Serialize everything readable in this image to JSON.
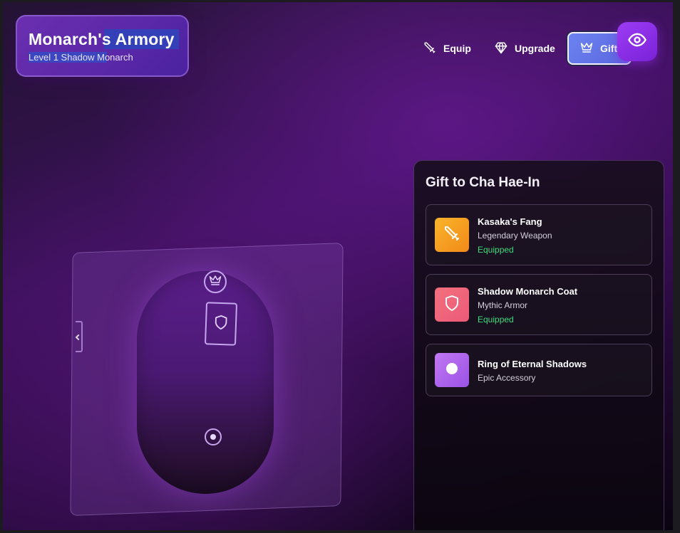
{
  "header": {
    "title": "Monarch's Armory",
    "subtitle": "Level 1 Shadow Monarch"
  },
  "nav": {
    "equip_label": "Equip",
    "upgrade_label": "Upgrade",
    "gift_label": "Gift",
    "active_tab": "Gift"
  },
  "icons": {
    "equip": "sword-icon",
    "upgrade": "gem-icon",
    "gift": "crown-icon",
    "toggle_view": "eye-icon",
    "slot_head": "crown-icon",
    "slot_body": "shield-icon",
    "slot_ring": "ring-icon"
  },
  "gift_panel": {
    "title": "Gift to Cha Hae-In",
    "items": [
      {
        "name": "Kasaka's Fang",
        "type": "Legendary Weapon",
        "status": "Equipped",
        "icon": "sword-icon",
        "color_from": "#f9b42a",
        "color_to": "#f28a1a"
      },
      {
        "name": "Shadow Monarch Coat",
        "type": "Mythic Armor",
        "status": "Equipped",
        "icon": "shield-icon",
        "color_from": "#f2707e",
        "color_to": "#ec5a78"
      },
      {
        "name": "Ring of Eternal Shadows",
        "type": "Epic Accessory",
        "status": "",
        "icon": "ring-icon",
        "color_from": "#c178f2",
        "color_to": "#9a52e6"
      }
    ]
  },
  "colors": {
    "accent": "#6d83f0",
    "equipped": "#3ddc7a",
    "eye_button": "#8a2be2"
  }
}
